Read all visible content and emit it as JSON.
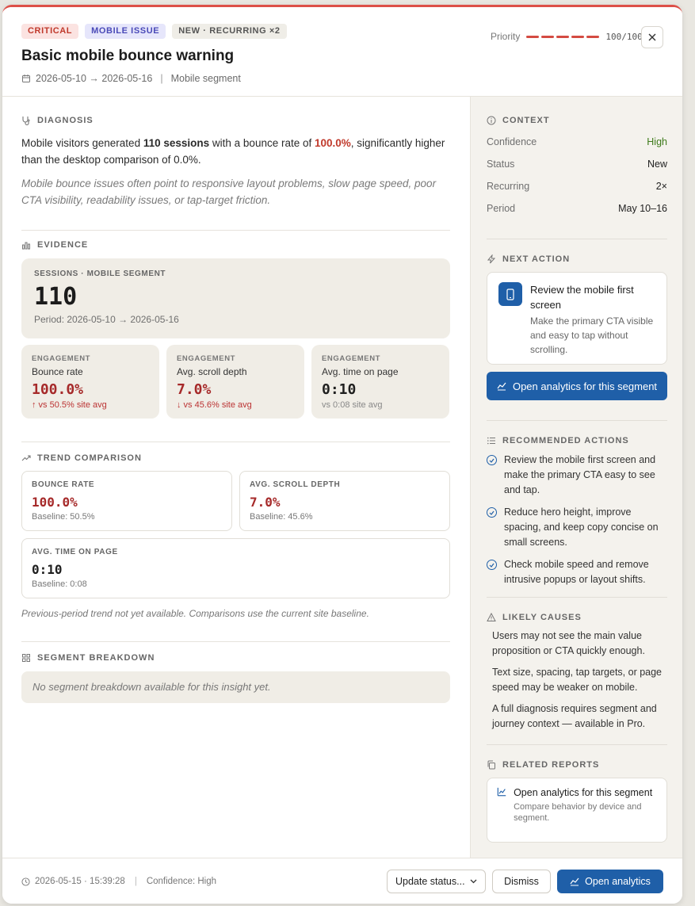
{
  "header": {
    "badges": {
      "critical": "CRITICAL",
      "mobile": "MOBILE ISSUE",
      "new": "NEW · RECURRING ×2"
    },
    "title": "Basic mobile bounce warning",
    "date_range": "2026-05-10 → 2026-05-16",
    "segment": "Mobile segment",
    "priority_label": "Priority",
    "priority_value": "100/100",
    "priority_level": 1.0
  },
  "diagnosis": {
    "label": "DIAGNOSIS",
    "text_1": "Mobile visitors generated ",
    "sessions_bold": "110 sessions",
    "text_2": " with a bounce rate of ",
    "bounce_red": "100.0%",
    "text_3": ", significantly higher than the desktop comparison of 0.0%.",
    "note": "Mobile bounce issues often point to responsive layout problems, slow page speed, poor CTA visibility, readability issues, or tap-target friction."
  },
  "evidence": {
    "label": "EVIDENCE",
    "big": {
      "label": "SESSIONS · MOBILE SEGMENT",
      "value": "110",
      "period": "Period: 2026-05-10 → 2026-05-16"
    },
    "cards": [
      {
        "label": "ENGAGEMENT",
        "name": "Bounce rate",
        "value": "100.0%",
        "sub": "↑ vs 50.5% site avg"
      },
      {
        "label": "ENGAGEMENT",
        "name": "Avg. scroll depth",
        "value": "7.0%",
        "sub": "↓ vs 45.6% site avg"
      },
      {
        "label": "ENGAGEMENT",
        "name": "Avg. time on page",
        "value": "0:10",
        "sub": "vs 0:08 site avg"
      }
    ]
  },
  "trend": {
    "label": "TREND COMPARISON",
    "cards": [
      {
        "label": "BOUNCE RATE",
        "value": "100.0%",
        "baseline": "Baseline: 50.5%"
      },
      {
        "label": "AVG. SCROLL DEPTH",
        "value": "7.0%",
        "baseline": "Baseline: 45.6%"
      },
      {
        "label": "AVG. TIME ON PAGE",
        "value": "0:10",
        "baseline": "Baseline: 0:08"
      }
    ],
    "footnote": "Previous-period trend not yet available. Comparisons use the current site baseline."
  },
  "segment": {
    "label": "SEGMENT BREAKDOWN",
    "empty": "No segment breakdown available for this insight yet."
  },
  "sidebar": {
    "context": {
      "label": "CONTEXT",
      "rows": [
        {
          "k": "Confidence",
          "v": "High"
        },
        {
          "k": "Status",
          "v": "New"
        },
        {
          "k": "Recurring",
          "v": "2×"
        },
        {
          "k": "Period",
          "v": "May 10–16"
        }
      ]
    },
    "next_action": {
      "label": "NEXT ACTION",
      "title": "Review the mobile first screen",
      "desc": "Make the primary CTA visible and easy to tap without scrolling.",
      "button": "Open analytics for this segment"
    },
    "recommended": {
      "label": "RECOMMENDED ACTIONS",
      "items": [
        "Review the mobile first screen and make the primary CTA easy to see and tap.",
        "Reduce hero height, improve spacing, and keep copy concise on small screens.",
        "Check mobile speed and remove intrusive popups or layout shifts."
      ]
    },
    "causes": {
      "label": "LIKELY CAUSES",
      "items": [
        "Users may not see the main value proposition or CTA quickly enough.",
        "Text size, spacing, tap targets, or page speed may be weaker on mobile.",
        "A full diagnosis requires segment and journey context — available in Pro."
      ]
    },
    "related": {
      "label": "RELATED REPORTS",
      "title": "Open analytics for this segment",
      "desc": "Compare behavior by device and segment."
    }
  },
  "footer": {
    "timestamp": "2026-05-15 · 15:39:28",
    "confidence": "Confidence: High",
    "status_select": "Update status...",
    "dismiss": "Dismiss",
    "open": "Open analytics"
  }
}
